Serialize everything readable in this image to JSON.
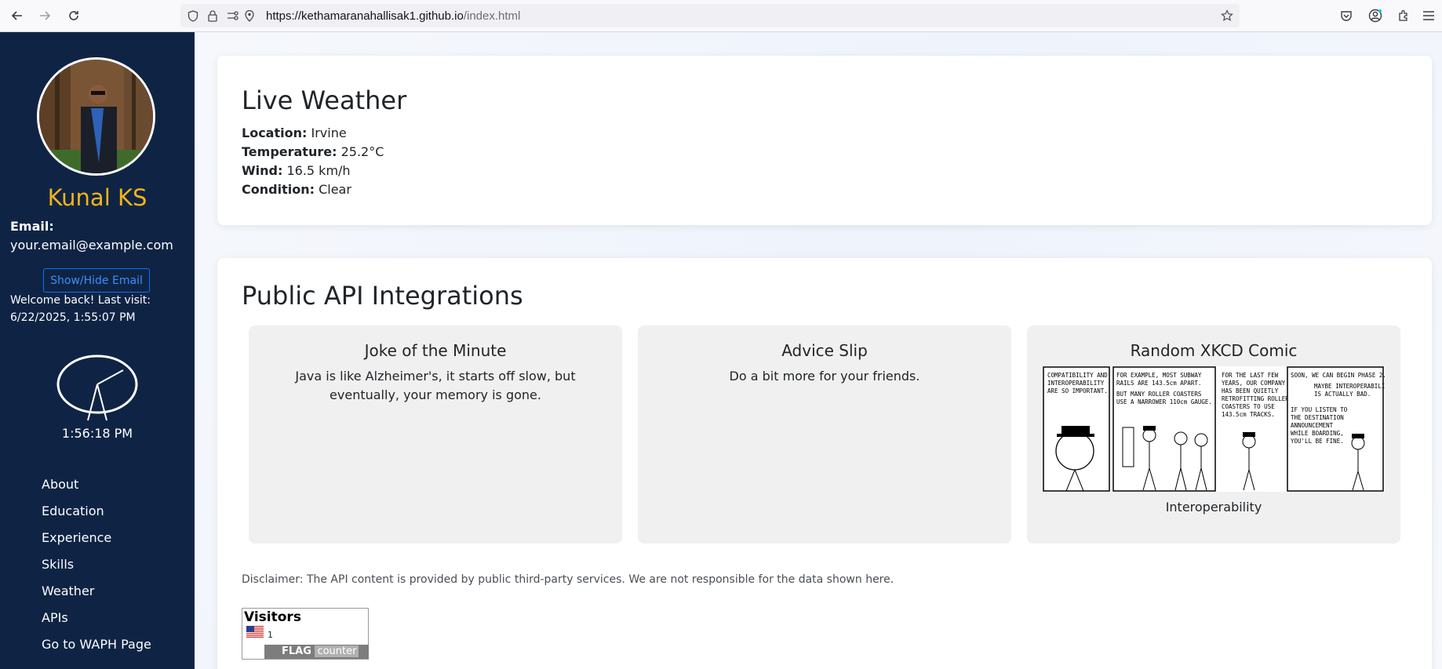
{
  "browser": {
    "url_main": "https://kethamaranahallisak1.github.io",
    "url_path": "/index.html"
  },
  "profile": {
    "name": "Kunal KS",
    "email_label": "Email:",
    "email": "your.email@example.com",
    "toggle_email_label": "Show/Hide Email",
    "welcome": "Welcome back! Last visit: 6/22/2025, 1:55:07 PM",
    "time": "1:56:18 PM"
  },
  "nav": {
    "items": [
      "About",
      "Education",
      "Experience",
      "Skills",
      "Weather",
      "APIs",
      "Go to WAPH Page"
    ]
  },
  "weather": {
    "title": "Live Weather",
    "location_label": "Location:",
    "location": "Irvine",
    "temperature_label": "Temperature:",
    "temperature": "25.2°C",
    "wind_label": "Wind:",
    "wind": "16.5 km/h",
    "condition_label": "Condition:",
    "condition": "Clear"
  },
  "apis": {
    "title": "Public API Integrations",
    "joke": {
      "title": "Joke of the Minute",
      "text": "Java is like Alzheimer's, it starts off slow, but eventually, your memory is gone."
    },
    "advice": {
      "title": "Advice Slip",
      "text": "Do a bit more for your friends."
    },
    "xkcd": {
      "title": "Random XKCD Comic",
      "caption": "Interoperability",
      "panels": [
        "COMPATIBILITY AND INTEROPERABILITY ARE SO IMPORTANT.",
        "FOR EXAMPLE, MOST SUBWAY RAILS ARE 143.5cm APART. BUT MANY ROLLER COASTERS USE A NARROWER 110cm GAUGE.",
        "FOR THE LAST FEW YEARS, OUR COMPANY HAS BEEN QUIETLY RETROFITTING ROLLER COASTERS TO USE 143.5cm TRACKS.",
        "SOON, WE CAN BEGIN PHASE 2. MAYBE INTEROPERABILITY IS ACTUALLY BAD. IF YOU LISTEN TO THE DESTINATION ANNOUNCEMENT WHILE BOARDING, YOU'LL BE FINE."
      ]
    },
    "disclaimer": "Disclaimer: The API content is provided by public third-party services. We are not responsible for the data shown here."
  },
  "visitors": {
    "title": "Visitors",
    "count": "1",
    "badge_a": "FLAG",
    "badge_b": "counter"
  }
}
